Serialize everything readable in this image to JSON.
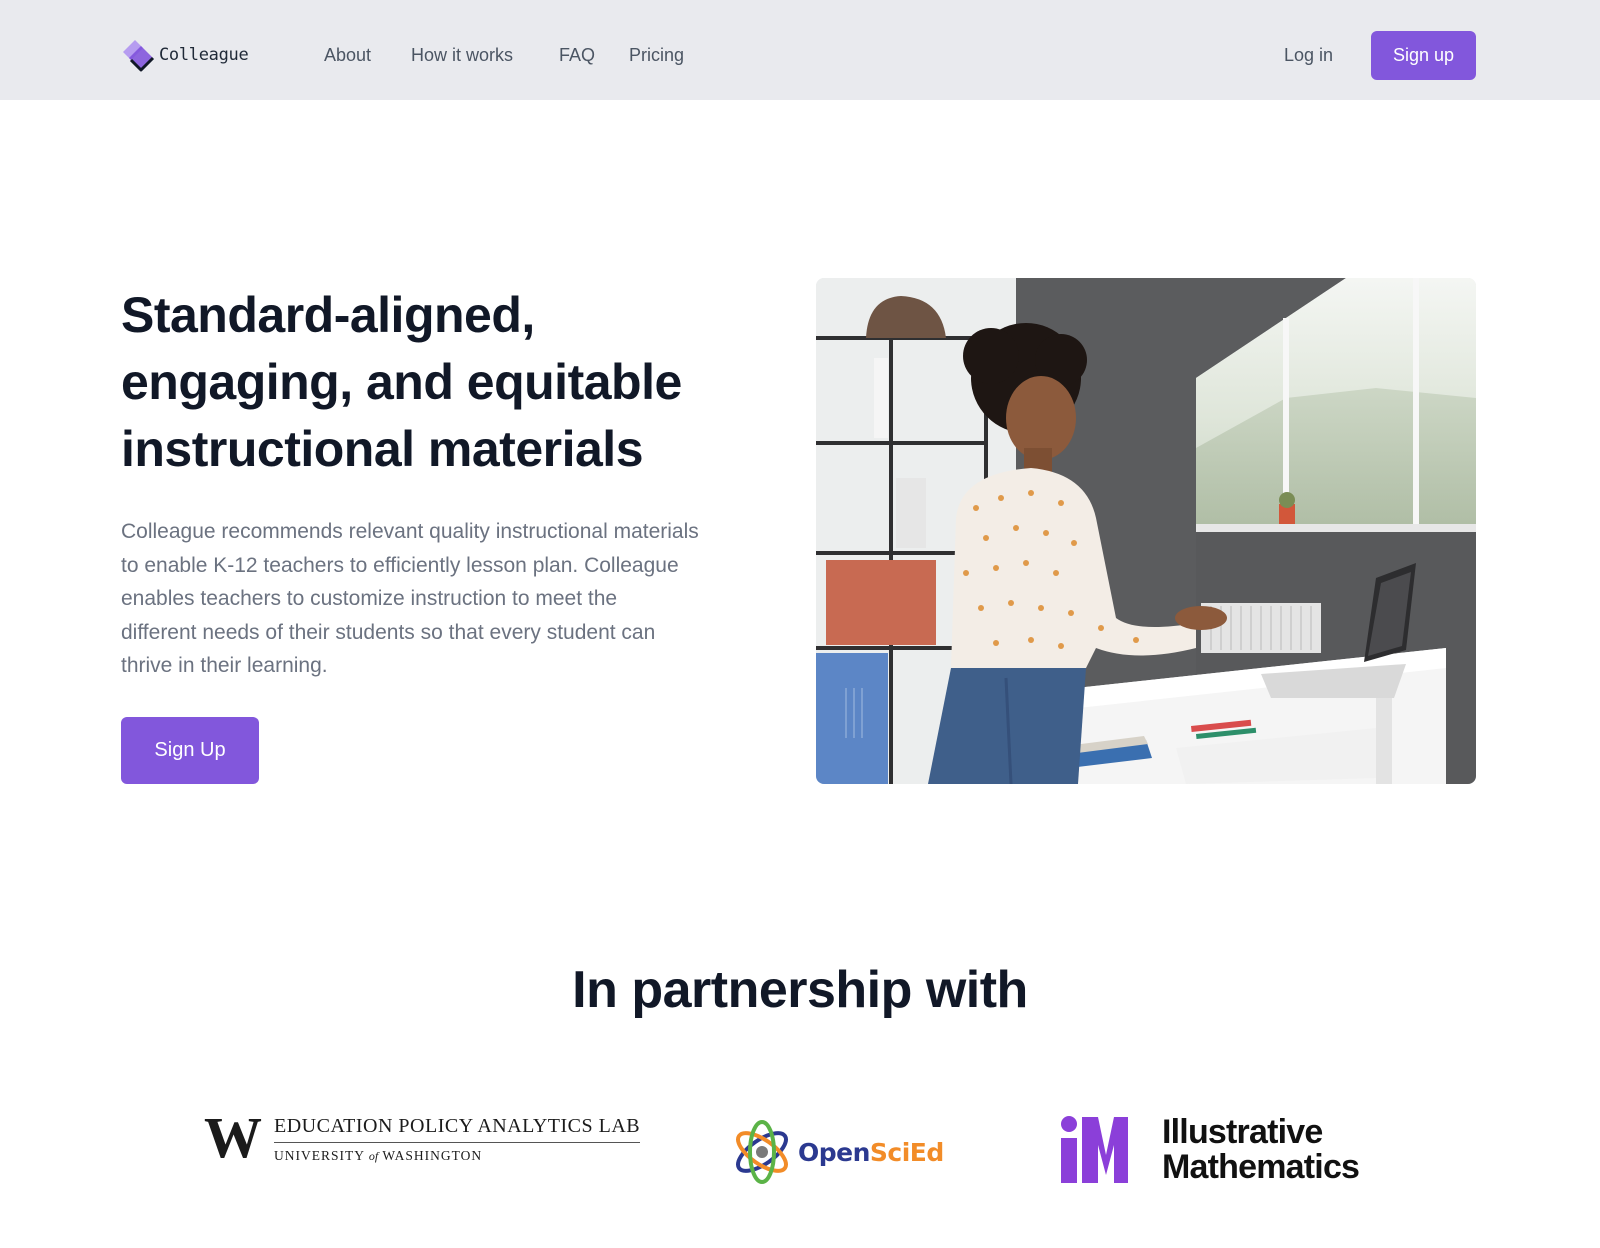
{
  "brand": {
    "name": "Colleague",
    "accent": "#8257dc"
  },
  "nav": {
    "items": [
      {
        "label": "About"
      },
      {
        "label": "How it works"
      },
      {
        "label": "FAQ"
      },
      {
        "label": "Pricing"
      }
    ],
    "login_label": "Log in",
    "signup_label": "Sign up"
  },
  "hero": {
    "title_lines": [
      "Standard-aligned,",
      "engaging, and equitable",
      "instructional materials"
    ],
    "description_lines": [
      "Colleague recommends relevant quality instructional materials",
      "to enable K-12 teachers to efficiently lesson plan. Colleague",
      "enables teachers to customize instruction to meet the",
      "different needs of their students so that every student can",
      "thrive in their learning."
    ],
    "cta_label": "Sign Up",
    "photo_icon": "teacher-photo"
  },
  "partners": {
    "title": "In partnership with",
    "uw": {
      "mark": "W",
      "line1": "EDUCATION POLICY ANALYTICS LAB",
      "line2_a": "UNIVERSITY ",
      "line2_of": "of",
      "line2_b": " WASHINGTON"
    },
    "openscied": {
      "part1": "Open",
      "part2": "SciEd"
    },
    "illustrative": {
      "line1": "Illustrative",
      "line2": "Mathematics"
    }
  }
}
